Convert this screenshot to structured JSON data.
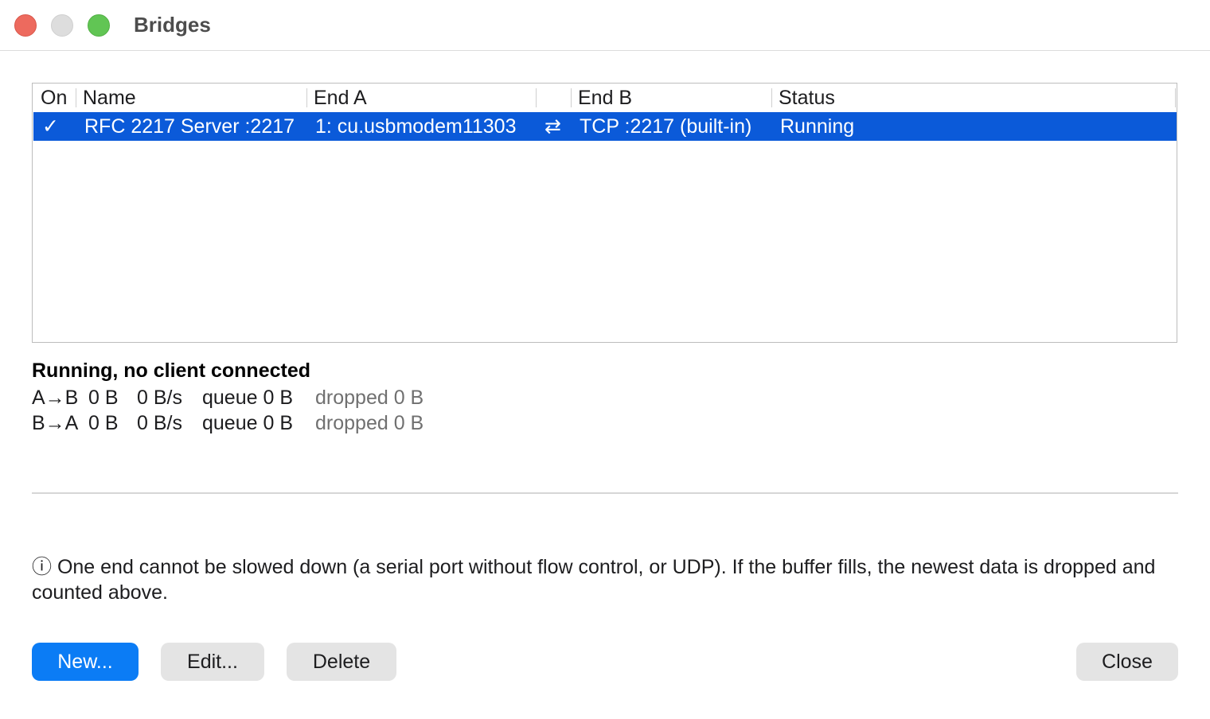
{
  "window": {
    "title": "Bridges"
  },
  "table": {
    "columns": {
      "on": "On",
      "name": "Name",
      "end_a": "End A",
      "end_b": "End B",
      "status": "Status"
    },
    "rows": [
      {
        "on": "✓",
        "name": "RFC 2217 Server :2217",
        "end_a": "1: cu.usbmodem11303",
        "direction": "⇄",
        "end_b": "TCP :2217 (built-in)",
        "status": "Running",
        "selected": true
      }
    ]
  },
  "details": {
    "heading": "Running, no client connected",
    "lines": [
      {
        "direction": "A→B",
        "bytes": "0 B",
        "rate": "0 B/s",
        "queue": "queue 0 B",
        "dropped": "dropped 0 B"
      },
      {
        "direction": "B→A",
        "bytes": "0 B",
        "rate": "0 B/s",
        "queue": "queue 0 B",
        "dropped": "dropped 0 B"
      }
    ]
  },
  "info": {
    "icon": "info-icon",
    "text": "ⓘ One end cannot be slowed down (a serial port without flow control, or UDP). If the buffer fills, the newest data is dropped and counted above."
  },
  "buttons": {
    "new": "New...",
    "edit": "Edit...",
    "delete": "Delete",
    "close": "Close"
  },
  "colors": {
    "selection": "#0b5ad9",
    "primary_button": "#0b7cf5",
    "traffic_close": "#ed6a5e",
    "traffic_min": "#dddddd",
    "traffic_max": "#61c554"
  }
}
